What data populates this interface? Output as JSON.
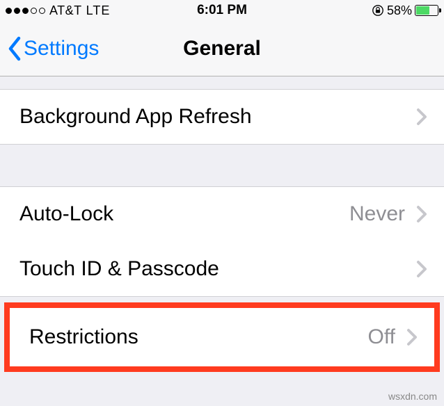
{
  "status_bar": {
    "signal_strength": 3,
    "signal_total": 5,
    "carrier": "AT&T",
    "network": "LTE",
    "time": "6:01 PM",
    "orientation_locked": true,
    "battery_percent_label": "58%",
    "battery_percent": 58
  },
  "nav": {
    "back_label": "Settings",
    "title": "General"
  },
  "rows": {
    "background_app_refresh": {
      "label": "Background App Refresh"
    },
    "auto_lock": {
      "label": "Auto-Lock",
      "value": "Never"
    },
    "touch_id_passcode": {
      "label": "Touch ID & Passcode"
    },
    "restrictions": {
      "label": "Restrictions",
      "value": "Off"
    }
  },
  "watermark": "wsxdn.com"
}
